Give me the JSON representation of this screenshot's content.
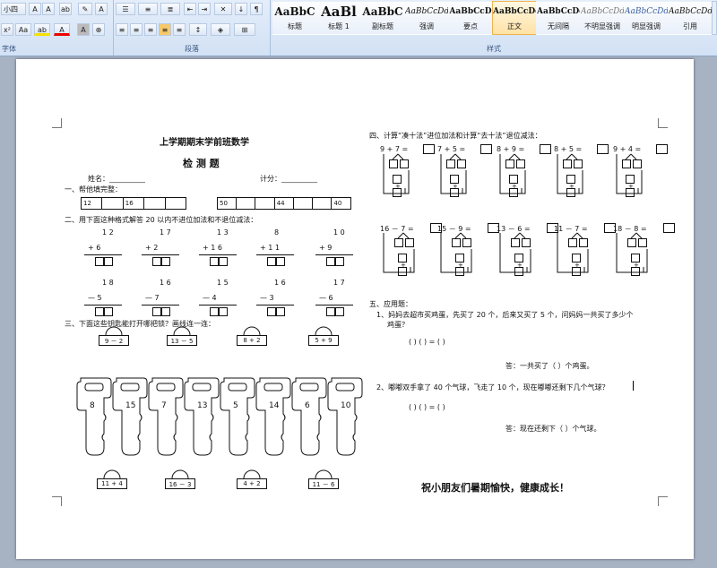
{
  "ribbon": {
    "font_size_value": "小四",
    "font_group_label": "字体",
    "paragraph_group_label": "段落",
    "styles_group_label": "样式",
    "styles": [
      {
        "sample": "AaBbC",
        "name": "标题"
      },
      {
        "sample": "AaBl",
        "name": "标题 1"
      },
      {
        "sample": "AaBbC",
        "name": "副标题"
      },
      {
        "sample": "AaBbCcDd",
        "name": "强调"
      },
      {
        "sample": "AaBbCcD",
        "name": "要点"
      },
      {
        "sample": "AaBbCcDd",
        "name": "正文"
      },
      {
        "sample": "AaBbCcDd",
        "name": "无间隔"
      },
      {
        "sample": "AaBbCcDd",
        "name": "不明显强调"
      },
      {
        "sample": "AaBbCcDd",
        "name": "明显强调"
      },
      {
        "sample": "AaBbCcDd",
        "name": "引用"
      }
    ],
    "selected_style": "正文",
    "accent_color": "#f0b34a"
  },
  "doc": {
    "title": "上学期期末学前班数学",
    "subtitle": "检 测 题",
    "name_label": "姓名：__________",
    "score_label": "计分：__________",
    "s1": {
      "heading": "一、帮他填完整：",
      "row1": [
        "12",
        "",
        "16",
        "",
        ""
      ],
      "row2": [
        "50",
        "",
        "",
        "44",
        "",
        "",
        "40"
      ]
    },
    "s2": {
      "heading": "二、用下面这种格式解答 20 以内不进位加法和不退位减法：",
      "add": [
        [
          "1 2",
          "+  6"
        ],
        [
          "1 7",
          "+  2"
        ],
        [
          "1 3",
          "+ 1 6"
        ],
        [
          "8",
          "+ 1 1"
        ],
        [
          "1 0",
          "+  9"
        ]
      ],
      "sub": [
        [
          "1 8",
          "—  5"
        ],
        [
          "1 6",
          "—  7"
        ],
        [
          "1 5",
          "—  4"
        ],
        [
          "1 6",
          "—  3"
        ],
        [
          "1 7",
          "—  6"
        ]
      ]
    },
    "s3": {
      "heading": "三、下面这些钥匙能打开哪把锁？画线连一连：",
      "locks_top": [
        "9 － 2",
        "13 － 5",
        "8 + 2",
        "5 + 9"
      ],
      "keys": [
        "8",
        "15",
        "7",
        "13",
        "5",
        "14",
        "6",
        "10"
      ],
      "locks_bottom": [
        "11 + 4",
        "16 － 3",
        "4 + 2",
        "11 － 6"
      ]
    },
    "s4": {
      "heading": "四、计算“凑十法”进位加法和计算“去十法”退位减法：",
      "add": [
        "9 + 7 =",
        "7 + 5 =",
        "8 + 9 =",
        "8 + 5 =",
        "9 + 4 ="
      ],
      "sub": [
        "16 － 7 =",
        "15 － 9 =",
        "13 － 6 =",
        "11 － 7 =",
        "18 － 8 ="
      ],
      "plus": "+",
      "minus": "－"
    },
    "s5": {
      "heading": "五、应用题：",
      "q1": "1、妈妈去超市买鸡蛋，先买了 20 个，后来又买了 5 个，问妈妈一共买了多少个",
      "q1b": "鸡蛋？",
      "formula": "(          )      (          )    =   (          )",
      "a1": "答：一共买了（        ）个鸡蛋。",
      "q2": "2、嘟嘟双手拿了 40 个气球，飞走了 10 个，现在嘟嘟还剩下几个气球？",
      "a2": "答：现在还剩下（        ）个气球。"
    },
    "closing": "祝小朋友们暑期愉快，健康成长！"
  }
}
